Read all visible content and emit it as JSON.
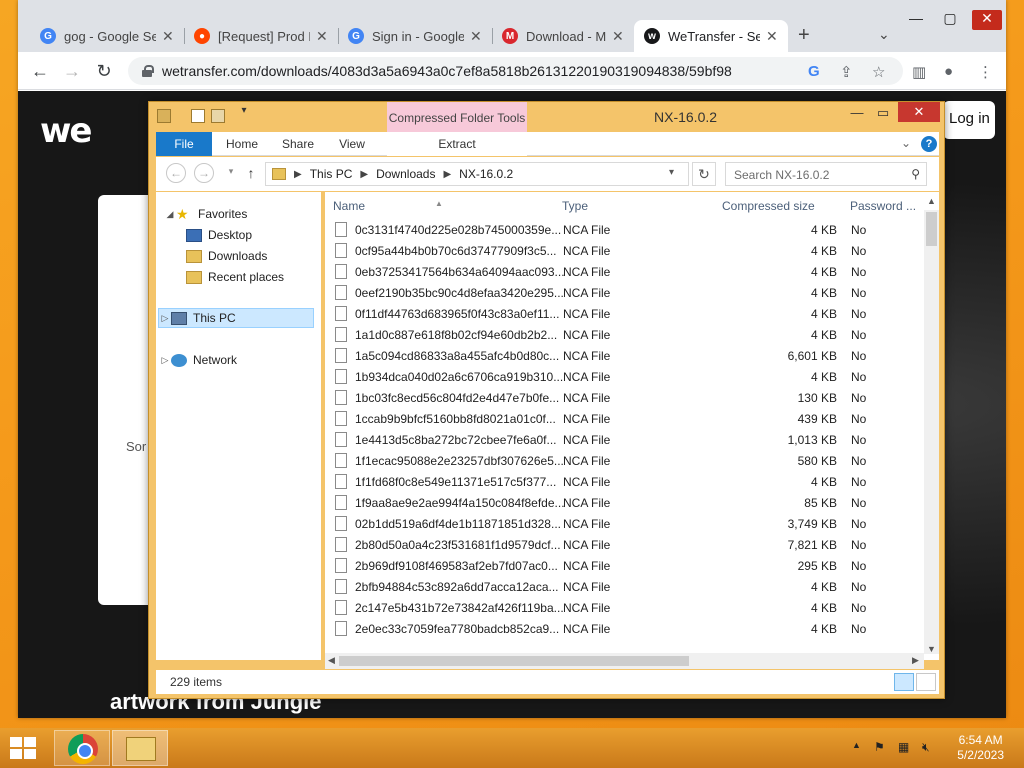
{
  "browser": {
    "tabs": [
      {
        "title": "gog - Google Search",
        "icon": "google-icon",
        "color": "#4285f4"
      },
      {
        "title": "[Request] Prod Keys",
        "icon": "reddit-icon",
        "color": "#ff4500"
      },
      {
        "title": "Sign in - Google Accounts",
        "icon": "google-icon",
        "color": "#4285f4"
      },
      {
        "title": "Download - MEGA",
        "icon": "mega-icon",
        "color": "#d9272e"
      },
      {
        "title": "WeTransfer - Send",
        "icon": "wetransfer-icon",
        "color": "#17181a"
      }
    ],
    "url": "wetransfer.com/downloads/4083d3a5a6943a0c7ef8a5818b26131220190319094838/59bf98"
  },
  "wetransfer": {
    "logo": "we",
    "login": "Log in",
    "partial_text": "Sor",
    "promo": [
      "",
      "",
      "artwork from Jungle"
    ]
  },
  "explorer": {
    "title": "NX-16.0.2",
    "context_tab": "Compressed Folder Tools",
    "ribbon_tabs": {
      "file": "File",
      "home": "Home",
      "share": "Share",
      "view": "View",
      "extract": "Extract"
    },
    "breadcrumb": [
      "This PC",
      "Downloads",
      "NX-16.0.2"
    ],
    "search_placeholder": "Search NX-16.0.2",
    "nav": {
      "favorites": "Favorites",
      "desktop": "Desktop",
      "downloads": "Downloads",
      "recent": "Recent places",
      "this_pc": "This PC",
      "network": "Network"
    },
    "columns": {
      "name": "Name",
      "type": "Type",
      "size": "Compressed size",
      "password": "Password ..."
    },
    "files": [
      {
        "name": "0c3131f4740d225e028b745000359e...",
        "type": "NCA File",
        "size": "4 KB",
        "password": "No"
      },
      {
        "name": "0cf95a44b4b0b70c6d37477909f3c5...",
        "type": "NCA File",
        "size": "4 KB",
        "password": "No"
      },
      {
        "name": "0eb37253417564b634a64094aac093...",
        "type": "NCA File",
        "size": "4 KB",
        "password": "No"
      },
      {
        "name": "0eef2190b35bc90c4d8efaa3420e295...",
        "type": "NCA File",
        "size": "4 KB",
        "password": "No"
      },
      {
        "name": "0f11df44763d683965f0f43c83a0ef11...",
        "type": "NCA File",
        "size": "4 KB",
        "password": "No"
      },
      {
        "name": "1a1d0c887e618f8b02cf94e60db2b2...",
        "type": "NCA File",
        "size": "4 KB",
        "password": "No"
      },
      {
        "name": "1a5c094cd86833a8a455afc4b0d80c...",
        "type": "NCA File",
        "size": "6,601 KB",
        "password": "No"
      },
      {
        "name": "1b934dca040d02a6c6706ca919b310...",
        "type": "NCA File",
        "size": "4 KB",
        "password": "No"
      },
      {
        "name": "1bc03fc8ecd56c804fd2e4d47e7b0fe...",
        "type": "NCA File",
        "size": "130 KB",
        "password": "No"
      },
      {
        "name": "1ccab9b9bfcf5160bb8fd8021a01c0f...",
        "type": "NCA File",
        "size": "439 KB",
        "password": "No"
      },
      {
        "name": "1e4413d5c8ba272bc72cbee7fe6a0f...",
        "type": "NCA File",
        "size": "1,013 KB",
        "password": "No"
      },
      {
        "name": "1f1ecac95088e2e23257dbf307626e5...",
        "type": "NCA File",
        "size": "580 KB",
        "password": "No"
      },
      {
        "name": "1f1fd68f0c8e549e11371e517c5f377...",
        "type": "NCA File",
        "size": "4 KB",
        "password": "No"
      },
      {
        "name": "1f9aa8ae9e2ae994f4a150c084f8efde...",
        "type": "NCA File",
        "size": "85 KB",
        "password": "No"
      },
      {
        "name": "02b1dd519a6df4de1b11871851d328...",
        "type": "NCA File",
        "size": "3,749 KB",
        "password": "No"
      },
      {
        "name": "2b80d50a0a4c23f531681f1d9579dcf...",
        "type": "NCA File",
        "size": "7,821 KB",
        "password": "No"
      },
      {
        "name": "2b969df9108f469583af2eb7fd07ac0...",
        "type": "NCA File",
        "size": "295 KB",
        "password": "No"
      },
      {
        "name": "2bfb94884c53c892a6dd7acca12aca...",
        "type": "NCA File",
        "size": "4 KB",
        "password": "No"
      },
      {
        "name": "2c147e5b431b72e73842af426f119ba...",
        "type": "NCA File",
        "size": "4 KB",
        "password": "No"
      },
      {
        "name": "2e0ec33c7059fea7780badcb852ca9...",
        "type": "NCA File",
        "size": "4 KB",
        "password": "No"
      }
    ],
    "status": "229 items"
  },
  "taskbar": {
    "time": "6:54 AM",
    "date": "5/2/2023"
  }
}
